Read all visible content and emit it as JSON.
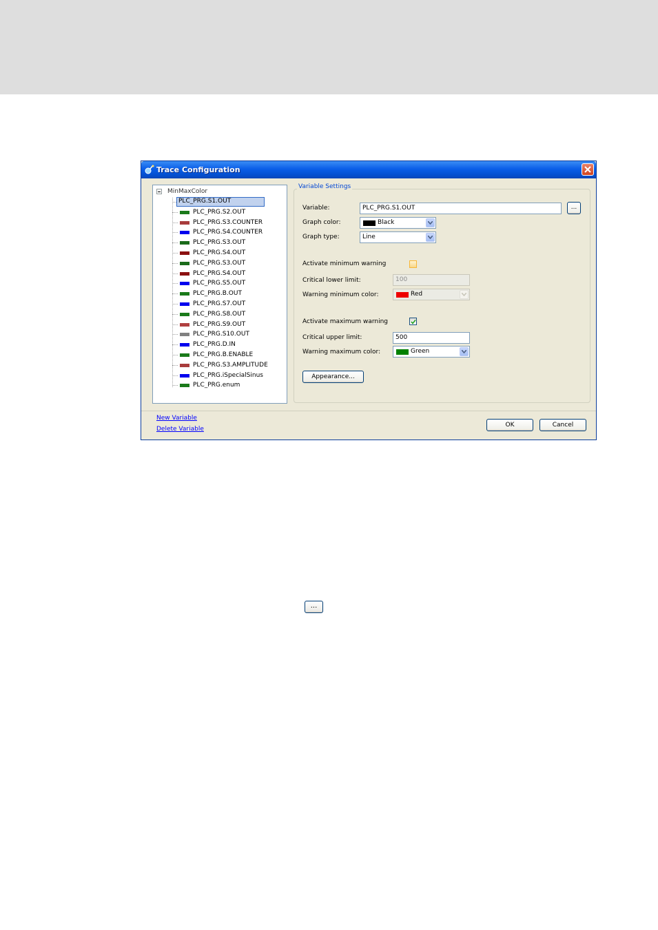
{
  "dialog": {
    "title": "Trace Configuration",
    "tree": {
      "root": "MinMaxColor",
      "items": [
        {
          "label": "PLC_PRG.S1.OUT",
          "color": "#000000",
          "selected": true
        },
        {
          "label": "PLC_PRG.S2.OUT",
          "color": "#1a7a1a"
        },
        {
          "label": "PLC_PRG.S3.COUNTER",
          "color": "#a83c3c"
        },
        {
          "label": "PLC_PRG.S4.COUNTER",
          "color": "#0000ee"
        },
        {
          "label": "PLC_PRG.S3.OUT",
          "color": "#1a6b1a"
        },
        {
          "label": "PLC_PRG.S4.OUT",
          "color": "#8b1010"
        },
        {
          "label": "PLC_PRG.S3.OUT",
          "color": "#1a6b1a"
        },
        {
          "label": "PLC_PRG.S4.OUT",
          "color": "#8b1010"
        },
        {
          "label": "PLC_PRG.S5.OUT",
          "color": "#0000ee"
        },
        {
          "label": "PLC_PRG.B.OUT",
          "color": "#1a7a1a"
        },
        {
          "label": "PLC_PRG.S7.OUT",
          "color": "#0000ee"
        },
        {
          "label": "PLC_PRG.S8.OUT",
          "color": "#1a7a1a"
        },
        {
          "label": "PLC_PRG.S9.OUT",
          "color": "#b04040"
        },
        {
          "label": "PLC_PRG.S10.OUT",
          "color": "#808080"
        },
        {
          "label": "PLC_PRG.D.IN",
          "color": "#0000ee"
        },
        {
          "label": "PLC_PRG.B.ENABLE",
          "color": "#1a7a1a"
        },
        {
          "label": "PLC_PRG.S3.AMPLITUDE",
          "color": "#a83c3c"
        },
        {
          "label": "PLC_PRG.iSpecialSinus",
          "color": "#0000ee"
        },
        {
          "label": "PLC_PRG.enum",
          "color": "#1a7a1a"
        }
      ]
    },
    "settings": {
      "legend": "Variable Settings",
      "variable_label": "Variable:",
      "variable_value": "PLC_PRG.S1.OUT",
      "browse_label": "...",
      "graph_color_label": "Graph color:",
      "graph_color_value": "Black",
      "graph_color_swatch": "#000000",
      "graph_type_label": "Graph type:",
      "graph_type_value": "Line",
      "min_warning_label": "Activate minimum warning",
      "min_warning_checked": false,
      "lower_limit_label": "Critical lower limit:",
      "lower_limit_value": "100",
      "min_color_label": "Warning minimum color:",
      "min_color_value": "Red",
      "min_color_swatch": "#ee0000",
      "max_warning_label": "Activate maximum warning",
      "max_warning_checked": true,
      "upper_limit_label": "Critical upper limit:",
      "upper_limit_value": "500",
      "max_color_label": "Warning maximum color:",
      "max_color_value": "Green",
      "max_color_swatch": "#008000",
      "appearance_label": "Appearance..."
    },
    "footer": {
      "new_variable": "New Variable",
      "delete_variable": "Delete Variable",
      "ok": "OK",
      "cancel": "Cancel"
    }
  },
  "standalone_button": "..."
}
